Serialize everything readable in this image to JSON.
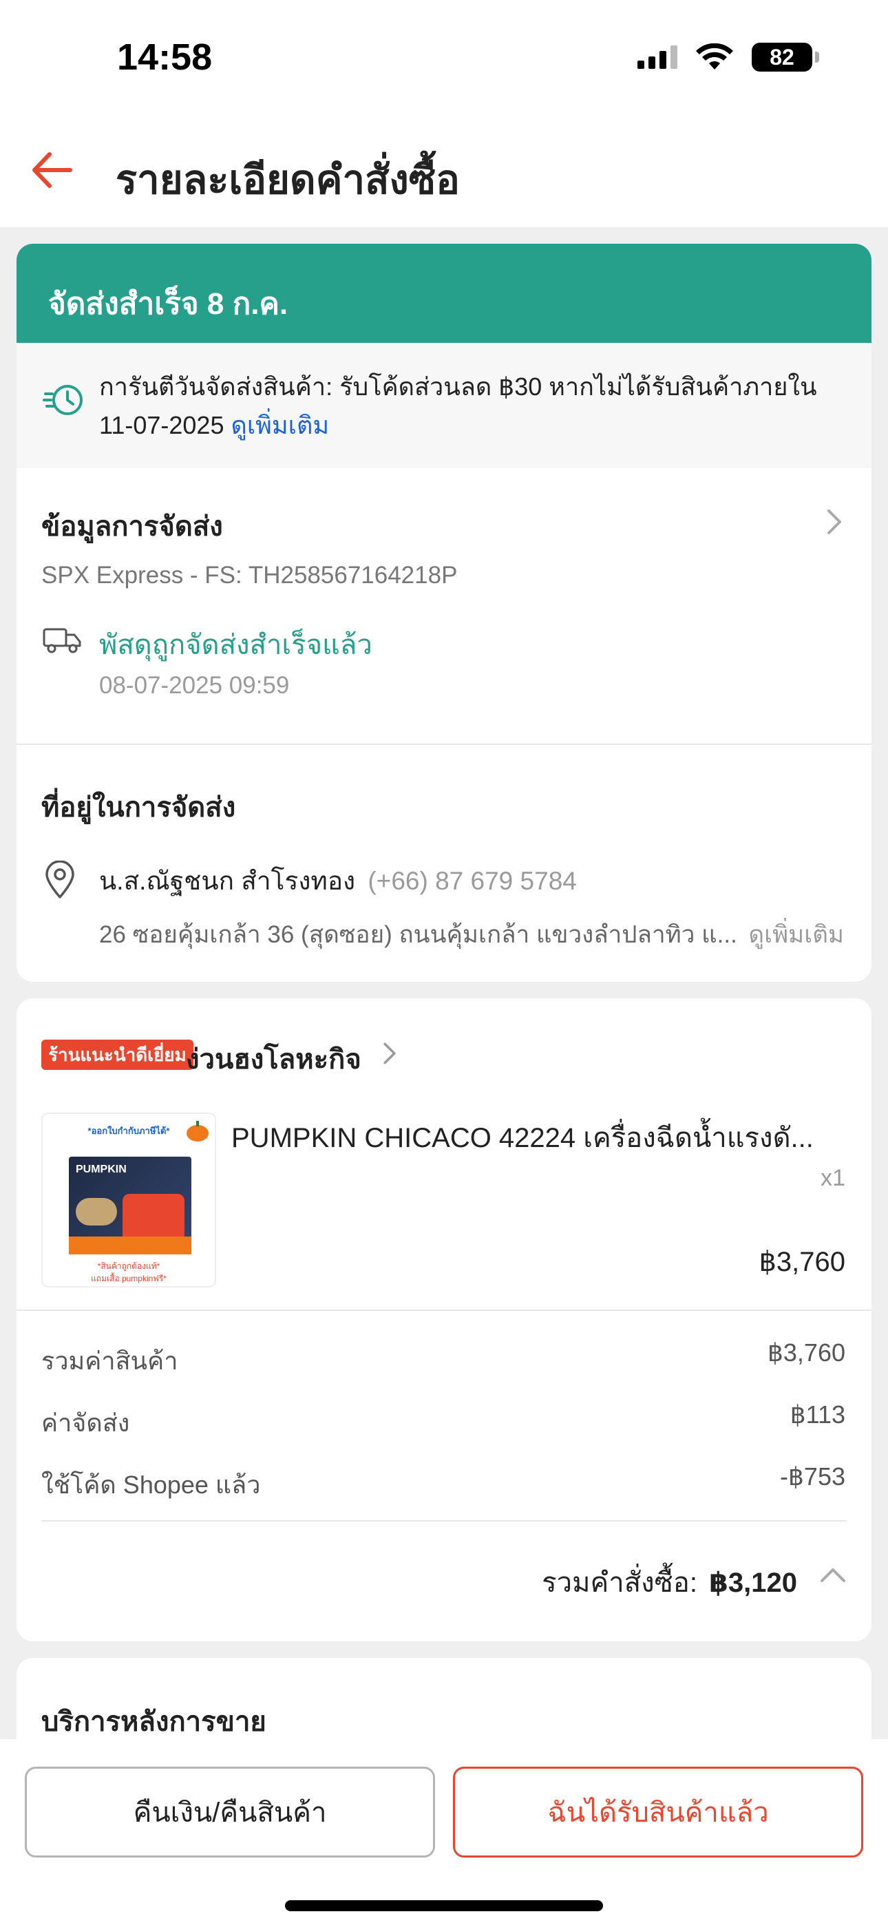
{
  "status_bar": {
    "time": "14:58",
    "battery": "82",
    "icons": [
      "signal-icon",
      "wifi-icon",
      "battery-icon"
    ]
  },
  "header": {
    "title": "รายละเอียดคำสั่งซื้อ",
    "back_icon": "back-arrow-icon"
  },
  "delivery_status": {
    "banner": "จัดส่งสำเร็จ 8 ก.ค.",
    "guarantee_text": "การันตีวันจัดส่งสินค้า: รับโค้ดส่วนลด ฿30 หากไม่ได้รับสินค้าภายใน",
    "guarantee_date": "11-07-2025",
    "guarantee_link": "ดูเพิ่มเติม"
  },
  "shipping_info": {
    "title": "ข้อมูลการจัดส่ง",
    "carrier": "SPX Express - FS: TH258567164218P",
    "status": "พัสดุถูกจัดส่งสำเร็จแล้ว",
    "timestamp": "08-07-2025 09:59"
  },
  "address": {
    "title": "ที่อยู่ในการจัดส่ง",
    "name": "น.ส.ณัฐชนก สำโรงทอง",
    "phone": "(+66) 87 679 5784",
    "line": "26 ซอยคุ้มเกล้า 36 (สุดซอย) ถนนคุ้มเกล้า แขวงลำปลาทิว แ...",
    "more_link": "ดูเพิ่มเติม"
  },
  "shop": {
    "badge": "ร้านแนะนำดีเยี่ยม",
    "name": "ง่วนฮงโลหะกิจ"
  },
  "product": {
    "name": "PUMPKIN CHICACO 42224 เครื่องฉีดน้ำแรงดั...",
    "qty": "x1",
    "price": "฿3,760",
    "image_texts": {
      "top": "*ออกใบกำกับภาษีได้*",
      "brand": "PUMPKIN",
      "bottom1": "*สินค้าถูกต้องแท้*",
      "bottom2": "แถมเสื้อ pumpkinฟรี*"
    }
  },
  "summary": {
    "subtotal_label": "รวมค่าสินค้า",
    "subtotal_value": "฿3,760",
    "shipping_label": "ค่าจัดส่ง",
    "shipping_value": "฿113",
    "voucher_label": "ใช้โค้ด Shopee แล้ว",
    "voucher_value": "-฿753",
    "total_label": "รวมคำสั่งซื้อ:",
    "total_value": "฿3,120"
  },
  "after_sales": {
    "title": "บริการหลังการขาย"
  },
  "actions": {
    "refund_label": "คืนเงิน/คืนสินค้า",
    "received_label": "ฉันได้รับสินค้าแล้ว"
  },
  "colors": {
    "accent": "#e8462e",
    "success": "#26a08b",
    "link": "#1a62d6"
  }
}
